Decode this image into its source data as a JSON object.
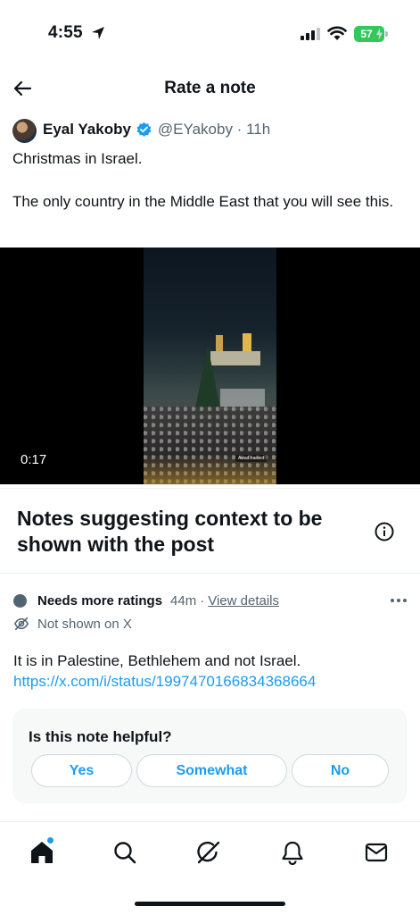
{
  "status_bar": {
    "time": "4:55",
    "battery": "57"
  },
  "header": {
    "title": "Rate a note"
  },
  "post": {
    "author_name": "Eyal Yakoby",
    "author_handle": "@EYakoby · 11h",
    "text": "Christmas in Israel.\n\nThe only country in the Middle East that you will see this.",
    "video_duration": "0:17",
    "video_watermark": "Awad hamed"
  },
  "notes": {
    "section_title": "Notes suggesting context to be shown with the post",
    "status_label": "Needs more ratings",
    "time_ago": "44m",
    "separator": "·",
    "view_details": "View details",
    "not_shown": "Not shown on X",
    "note_text": "It is in Palestine, Bethlehem and not Israel.",
    "note_link": "https://x.com/i/status/1997470166834368664"
  },
  "rating": {
    "question": "Is this note helpful?",
    "options": [
      "Yes",
      "Somewhat",
      "No"
    ]
  },
  "colors": {
    "accent": "#1d9bf0",
    "text_primary": "#0f1419",
    "text_secondary": "#536471",
    "battery": "#34c759"
  },
  "tabbar": {
    "icons": [
      "home-icon",
      "search-icon",
      "grok-icon",
      "notifications-icon",
      "messages-icon"
    ]
  }
}
